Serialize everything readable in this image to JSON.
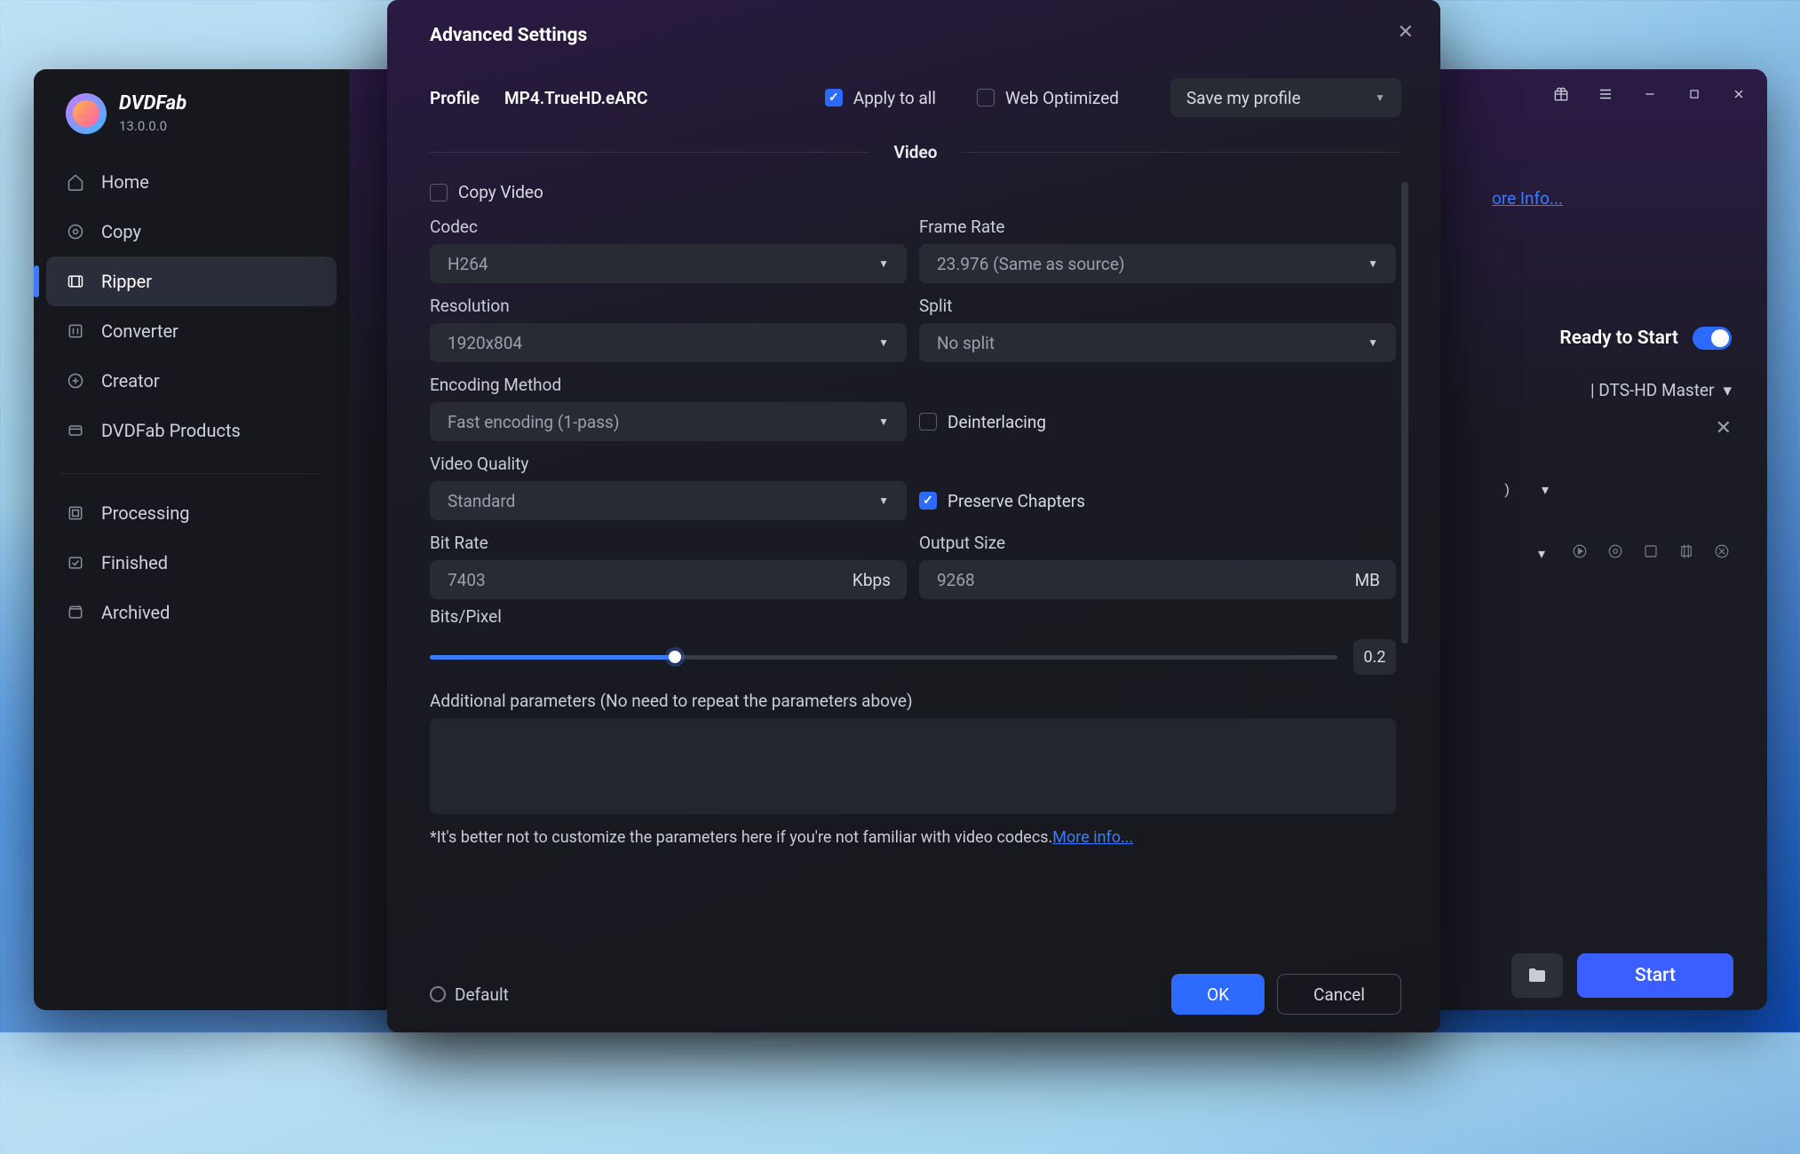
{
  "app": {
    "name": "DVDFab",
    "version": "13.0.0.0"
  },
  "sidebar": {
    "items": [
      {
        "label": "Home"
      },
      {
        "label": "Copy"
      },
      {
        "label": "Ripper"
      },
      {
        "label": "Converter"
      },
      {
        "label": "Creator"
      },
      {
        "label": "DVDFab Products"
      }
    ],
    "bottom": [
      {
        "label": "Processing"
      },
      {
        "label": "Finished"
      },
      {
        "label": "Archived"
      }
    ]
  },
  "background": {
    "more_info": "ore Info...",
    "ready": "Ready to Start",
    "audio_frag": "| DTS-HD Master",
    "sub_frag": ")",
    "start": "Start"
  },
  "modal": {
    "title": "Advanced Settings",
    "profile_label": "Profile",
    "profile_name": "MP4.TrueHD.eARC",
    "apply_all": "Apply to all",
    "web_optimized": "Web Optimized",
    "save_profile": "Save my profile",
    "section_video": "Video",
    "copy_video": "Copy Video",
    "fields": {
      "codec_label": "Codec",
      "codec_value": "H264",
      "framerate_label": "Frame Rate",
      "framerate_value": "23.976 (Same as source)",
      "resolution_label": "Resolution",
      "resolution_value": "1920x804",
      "split_label": "Split",
      "split_value": "No split",
      "encoding_label": "Encoding Method",
      "encoding_value": "Fast encoding (1-pass)",
      "deinterlacing": "Deinterlacing",
      "quality_label": "Video Quality",
      "quality_value": "Standard",
      "preserve_chapters": "Preserve Chapters",
      "bitrate_label": "Bit Rate",
      "bitrate_value": "7403",
      "bitrate_unit": "Kbps",
      "outputsize_label": "Output Size",
      "outputsize_value": "9268",
      "outputsize_unit": "MB",
      "bitspixel_label": "Bits/Pixel",
      "bitspixel_value": "0.2",
      "additional_label": "Additional parameters (No need to repeat the parameters above)",
      "codec_note_pre": "*It's better not to customize the parameters here if you're not familiar with video codecs.",
      "codec_note_link": "More info..."
    },
    "footer": {
      "default": "Default",
      "ok": "OK",
      "cancel": "Cancel"
    }
  }
}
